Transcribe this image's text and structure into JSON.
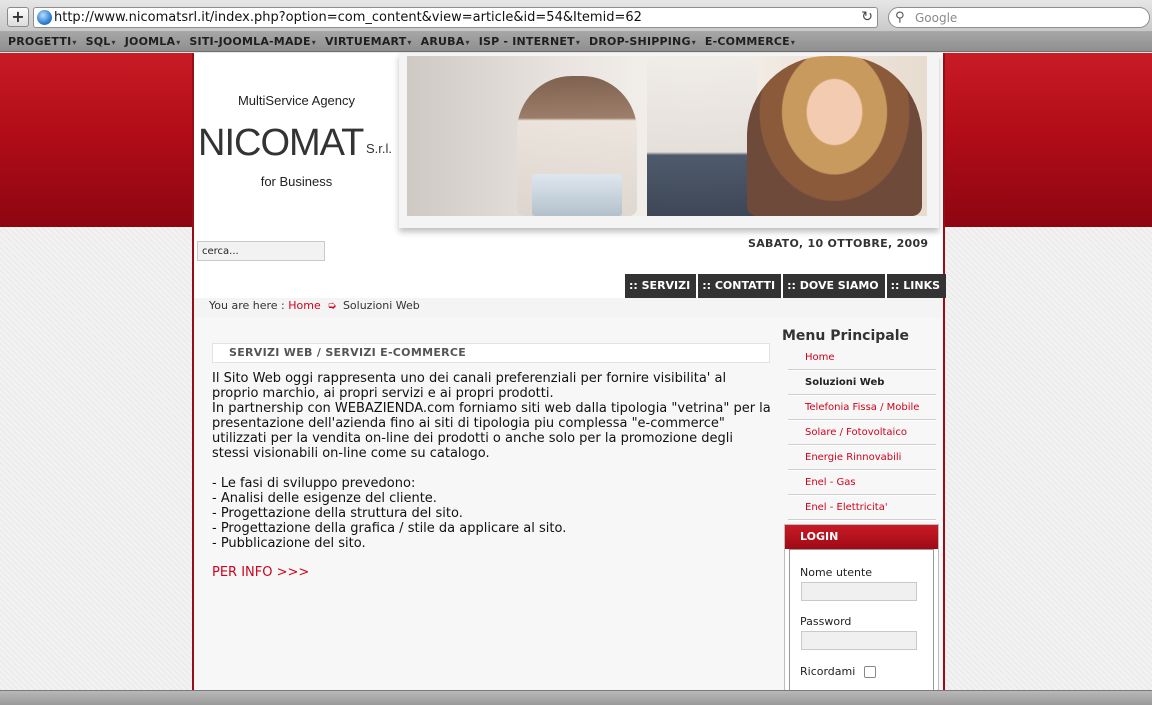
{
  "browser": {
    "url": "http://www.nicomatsrl.it/index.php?option=com_content&view=article&id=54&Itemid=62",
    "search_placeholder": "Google",
    "add_icon": "+",
    "reload_icon": "↻",
    "search_icon": "⚲",
    "bookmarks": [
      {
        "label": "PROGETTI"
      },
      {
        "label": "SQL"
      },
      {
        "label": "JOOMLA"
      },
      {
        "label": "SITI-JOOMLA-MADE"
      },
      {
        "label": "VIRTUEMART"
      },
      {
        "label": "ARUBA"
      },
      {
        "label": "ISP - INTERNET"
      },
      {
        "label": "DROP-SHIPPING"
      },
      {
        "label": "E-COMMERCE"
      }
    ],
    "dropdown_arrow": "▾"
  },
  "header": {
    "tagline": "MultiService Agency",
    "brand": "NICOMAT",
    "brand_suffix": "S.r.l.",
    "subline": "for Business",
    "date": "SABATO, 10 OTTOBRE, 2009",
    "search_value": "cerca..."
  },
  "topnav": [
    {
      "label": ":: SERVIZI"
    },
    {
      "label": ":: CONTATTI"
    },
    {
      "label": ":: DOVE SIAMO"
    },
    {
      "label": ":: LINKS"
    }
  ],
  "breadcrumb": {
    "prefix": "You are here :",
    "home": "Home",
    "arrow": "➭",
    "current": "Soluzioni Web"
  },
  "article": {
    "title": "SERVIZI WEB / SERVIZI E-COMMERCE",
    "paragraphs": [
      "Il Sito Web oggi rappresenta uno dei canali preferenziali per fornire visibilita' al proprio marchio, ai propri servizi e ai propri prodotti.",
      "In partnership con WEBAZIENDA.com forniamo siti web dalla tipologia \"vetrina\" per la presentazione dell'azienda fino ai siti di tipologia piu complessa \"e-commerce\" utilizzati per la vendita on-line dei prodotti o anche solo per la promozione degli stessi visionabili on-line come su catalogo.",
      "- Le fasi di sviluppo prevedono:",
      "- Analisi delle esigenze del cliente.",
      "- Progettazione della struttura del sito.",
      "- Progettazione della grafica / stile da applicare al sito.",
      "- Pubblicazione del sito."
    ],
    "link": "PER INFO >>>"
  },
  "sidebar": {
    "menu_title": "Menu Principale",
    "items": [
      {
        "label": "Home",
        "active": false
      },
      {
        "label": "Soluzioni Web",
        "active": true
      },
      {
        "label": "Telefonia Fissa / Mobile",
        "active": false
      },
      {
        "label": "Solare / Fotovoltaico",
        "active": false
      },
      {
        "label": "Energie Rinnovabili",
        "active": false
      },
      {
        "label": "Enel - Gas",
        "active": false
      },
      {
        "label": "Enel - Elettricita'",
        "active": false
      }
    ],
    "login": {
      "title": "LOGIN",
      "username_label": "Nome utente",
      "password_label": "Password",
      "remember_label": "Ricordami"
    }
  },
  "colors": {
    "accent_red": "#d0021b",
    "band_red": "#b20d18",
    "nav_dark": "#333333"
  }
}
